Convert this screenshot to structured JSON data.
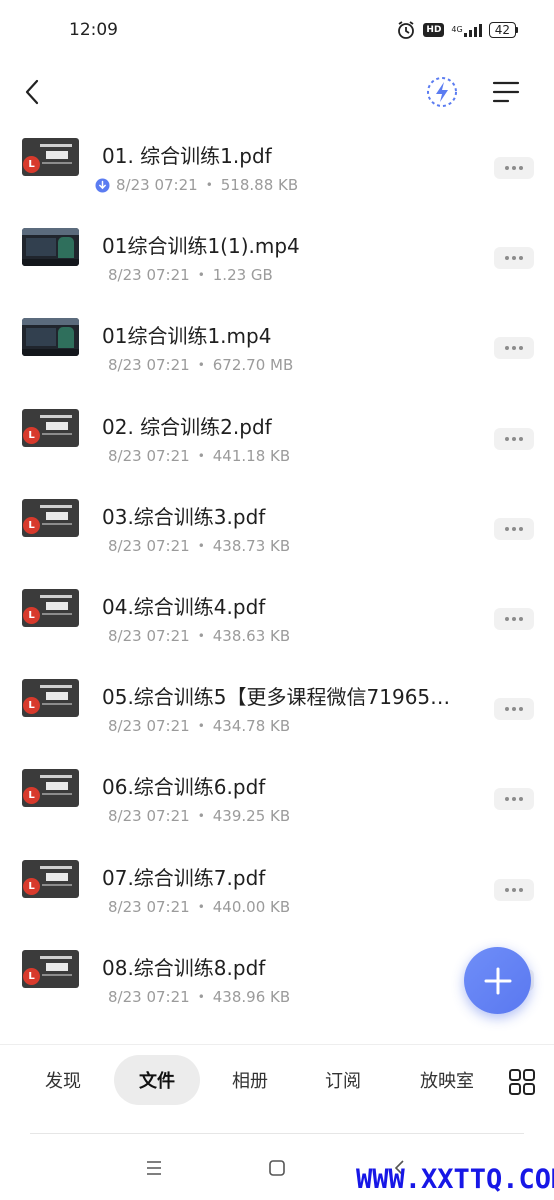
{
  "status_bar": {
    "time": "12:09",
    "alarm_icon": "alarm-clock-icon",
    "hd_label": "HD",
    "network_label": "4G",
    "battery_level": "42"
  },
  "header": {
    "back_icon": "back-arrow-icon",
    "flash_icon": "flash-transfer-icon",
    "sort_icon": "sort-list-icon",
    "accent_color": "#5b7cf1"
  },
  "files": [
    {
      "name": "01. 综合训练1.pdf",
      "date": "8/23 07:21",
      "size": "518.88 KB",
      "type": "pdf",
      "downloaded": true
    },
    {
      "name": "01综合训练1(1).mp4",
      "date": "8/23 07:21",
      "size": "1.23 GB",
      "type": "video",
      "downloaded": false
    },
    {
      "name": "01综合训练1.mp4",
      "date": "8/23 07:21",
      "size": "672.70 MB",
      "type": "video",
      "downloaded": false
    },
    {
      "name": "02. 综合训练2.pdf",
      "date": "8/23 07:21",
      "size": "441.18 KB",
      "type": "pdf",
      "downloaded": false
    },
    {
      "name": "03.综合训练3.pdf",
      "date": "8/23 07:21",
      "size": "438.73 KB",
      "type": "pdf",
      "downloaded": false
    },
    {
      "name": "04.综合训练4.pdf",
      "date": "8/23 07:21",
      "size": "438.63 KB",
      "type": "pdf",
      "downloaded": false
    },
    {
      "name": "05.综合训练5【更多课程微信71965…",
      "date": "8/23 07:21",
      "size": "434.78 KB",
      "type": "pdf",
      "downloaded": false
    },
    {
      "name": "06.综合训练6.pdf",
      "date": "8/23 07:21",
      "size": "439.25 KB",
      "type": "pdf",
      "downloaded": false
    },
    {
      "name": "07.综合训练7.pdf",
      "date": "8/23 07:21",
      "size": "440.00 KB",
      "type": "pdf",
      "downloaded": false
    },
    {
      "name": "08.综合训练8.pdf",
      "date": "8/23 07:21",
      "size": "438.96 KB",
      "type": "pdf",
      "downloaded": false
    }
  ],
  "meta_separator": "•",
  "pdf_logo_letter": "L",
  "fab": {
    "icon": "plus-icon"
  },
  "tabs": [
    {
      "label": "发现",
      "active": false
    },
    {
      "label": "文件",
      "active": true
    },
    {
      "label": "相册",
      "active": false
    },
    {
      "label": "订阅",
      "active": false
    },
    {
      "label": "放映室",
      "active": false
    }
  ],
  "grid_icon": "grid-icon",
  "system_nav": [
    "menu-icon",
    "home-square-icon",
    "back-chevron-icon"
  ],
  "watermark": "WWW.XXTTQ.COM"
}
